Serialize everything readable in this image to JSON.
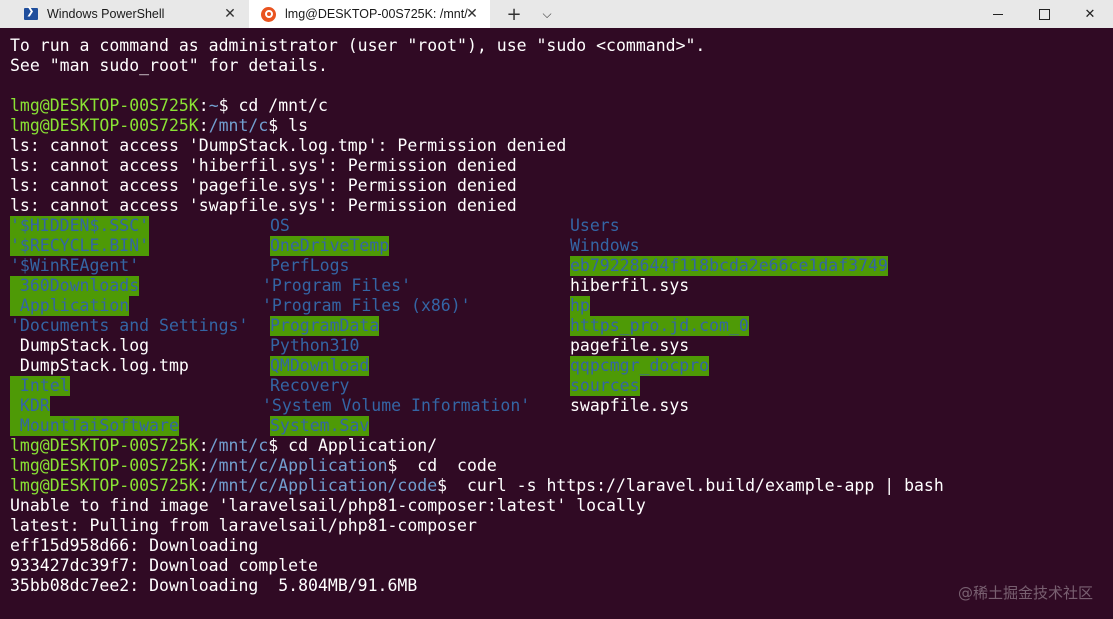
{
  "tabs": [
    {
      "title": "Windows PowerShell",
      "icon": "powershell-icon"
    },
    {
      "title": "lmg@DESKTOP-00S725K: /mnt/",
      "icon": "ubuntu-icon"
    }
  ],
  "tab_controls": {
    "close": "✕",
    "new": "+",
    "dropdown": "⌵"
  },
  "window_controls": {
    "close": "✕"
  },
  "terminal": {
    "l0": "To run a command as administrator (user \"root\"), use \"sudo <command>\".",
    "l1": "See \"man sudo_root\" for details.",
    "p_user": "lmg@DESKTOP-00S725K",
    "p_colon": ":",
    "p_home": "~",
    "p_dollar": "$ ",
    "cmd1": "cd /mnt/c",
    "p_mntc": "/mnt/c",
    "cmd2": "ls",
    "err1": "ls: cannot access 'DumpStack.log.tmp': Permission denied",
    "err2": "ls: cannot access 'hiberfil.sys': Permission denied",
    "err3": "ls: cannot access 'pagefile.sys': Permission denied",
    "err4": "ls: cannot access 'swapfile.sys': Permission denied",
    "cmd3": "cd Application/",
    "p_app": "/mnt/c/Application",
    "cmd4": " cd  code",
    "p_code": "/mnt/c/Application/code",
    "cmd5": " curl -s https://laravel.build/example-app | bash",
    "o1": "Unable to find image 'laravelsail/php81-composer:latest' locally",
    "o2": "latest: Pulling from laravelsail/php81-composer",
    "o3": "eff15d958d66: Downloading",
    "o4": "933427dc39f7: Download complete",
    "o5": "35bb08dc7ee2: Downloading  5.804MB/91.6MB"
  },
  "ls_rows": [
    [
      "'$HIDDEN$.SSC'",
      "OS",
      "Users"
    ],
    [
      "'$RECYCLE.BIN'",
      "OneDriveTemp",
      "Windows"
    ],
    [
      "'$WinREAgent'",
      "PerfLogs",
      "eb79228644f118bcda2e66ce1daf3749"
    ],
    [
      " 360Downloads",
      "'Program Files'",
      "hiberfil.sys"
    ],
    [
      " Application",
      "'Program Files (x86)'",
      "hp"
    ],
    [
      "'Documents and Settings'",
      "ProgramData",
      "https_pro.jd.com_0"
    ],
    [
      " DumpStack.log",
      "Python310",
      "pagefile.sys"
    ],
    [
      " DumpStack.log.tmp",
      "QMDownload",
      "qqpcmgr_docpro"
    ],
    [
      " Intel",
      "Recovery",
      "sources"
    ],
    [
      " KDR",
      "'System Volume Information'",
      "swapfile.sys"
    ],
    [
      " MountTaiSoftware",
      "System.Sav",
      ""
    ]
  ],
  "watermark": "@稀土掘金技术社区"
}
